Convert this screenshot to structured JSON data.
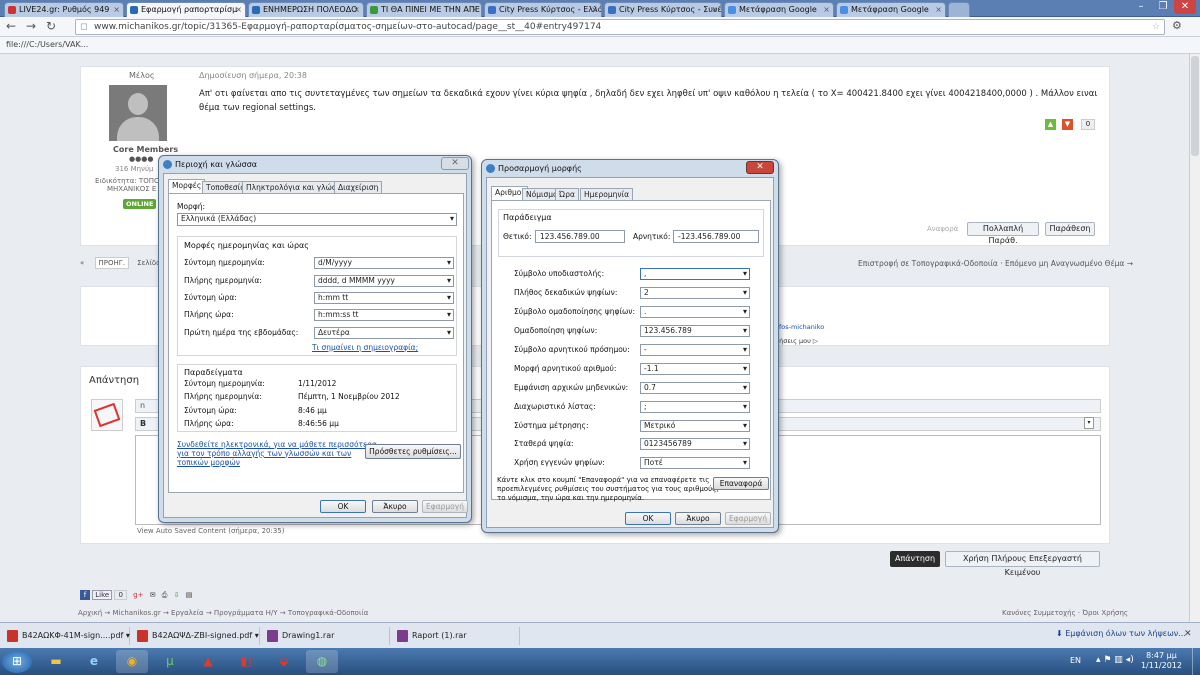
{
  "browser": {
    "tabs": [
      {
        "label": "LIVE24.gr: Ρυθμός 949",
        "active": false
      },
      {
        "label": "Εφαρμογή ραπορταρίσμ",
        "active": true
      },
      {
        "label": "ΕΝΗΜΕΡΩΣΗ ΠΟΛΕΟΔΟ",
        "active": false
      },
      {
        "label": "ΤΙ ΘΑ ΠΙΝΕΙ ΜΕ ΤΗΝ ΑΠΕ",
        "active": false
      },
      {
        "label": "City Press Κύρτσος - Ελλά",
        "active": false
      },
      {
        "label": "City Press Κύρτσος - Συνέ",
        "active": false
      },
      {
        "label": "Μετάφραση Google",
        "active": false
      },
      {
        "label": "Μετάφραση Google",
        "active": false
      }
    ],
    "url": "www.michanikos.gr/topic/31365-Εφαρμογή-ραπορταρίσματος-σημείων-στο-autocad/page__st__40#entry497174",
    "bookmark": "file:///C:/Users/VAK..."
  },
  "forum": {
    "author_name": "Μέλος",
    "post_date": "Δημοσίευση σήμερα, 20:38",
    "post_text": "Απ' οτι φαίνεται απο τις συντεταγμένες των σημείων  τα δεκαδικά εχουν γίνει κύρια ψηφία , δηλαδή δεν εχει ληφθεί υπ' οψιν καθόλου η τελεία ( το Χ= 400421.8400  εχει γίνει  4004218400,0000  ) . Μάλλον ειναι θέμα των regional settings.",
    "rank": "Core Members",
    "post_count": "316 Μηνύμ",
    "specialty_line1": "Ειδικότητα: ΤΟΠΟ",
    "specialty_line2": "ΜΗΧΑΝΙΚΟΣ Ε",
    "online_badge": "ONLINE",
    "rep_count": "0",
    "report_label": "Αναφορά",
    "multi_quote_label": "Πολλαπλή Παράθ.",
    "quote_label": "Παράθεση",
    "prev_label": "ΠΡΟΗΓ.",
    "page_label": "Σελίδα",
    "nav_links": "Επιστροφή σε Τοπογραφικά-Οδοποιία · Επόμενο μη Αναγνωσμένο Θέμα →",
    "link_fragment": "ofos-michaniko",
    "share_fragment": "ρήσεις μου",
    "reply_heading": "Απάντηση",
    "autosave_text": "View Auto Saved Content (σήμερα, 20:35)",
    "reply_button": "Απάντηση",
    "full_editor_button": "Χρήση Πλήρους Επεξεργαστή Κειμένου",
    "like_label": "Like",
    "like_count": "0",
    "breadcrumb": "Αρχική  →  Michanikos.gr  →  Εργαλεία  →  Προγράμματα Η/Υ  →  Τοπογραφικά-Οδοποιία",
    "footer_links": "Κανόνες Συμμετοχής · Όροι Χρήσης"
  },
  "region_dialog": {
    "title": "Περιοχή και γλώσσα",
    "tabs": [
      "Μορφές",
      "Τοποθεσία",
      "Πληκτρολόγια και γλώσσες",
      "Διαχείριση"
    ],
    "format_label": "Μορφή:",
    "format_value": "Ελληνικά (Ελλάδας)",
    "group_title": "Μορφές ημερομηνίας και ώρας",
    "rows": [
      {
        "label": "Σύντομη ημερομηνία:",
        "value": "d/M/yyyy"
      },
      {
        "label": "Πλήρης ημερομηνία:",
        "value": "dddd, d MMMM yyyy"
      },
      {
        "label": "Σύντομη ώρα:",
        "value": "h:mm tt"
      },
      {
        "label": "Πλήρης ώρα:",
        "value": "h:mm:ss tt"
      },
      {
        "label": "Πρώτη ημέρα της εβδομάδας:",
        "value": "Δευτέρα"
      }
    ],
    "notation_link": "Τι σημαίνει η σημειογραφία;",
    "examples_title": "Παραδείγματα",
    "examples": [
      {
        "label": "Σύντομη ημερομηνία:",
        "value": "1/11/2012"
      },
      {
        "label": "Πλήρης ημερομηνία:",
        "value": "Πέμπτη, 1 Νοεμβρίου 2012"
      },
      {
        "label": "Σύντομη ώρα:",
        "value": "8:46 μμ"
      },
      {
        "label": "Πλήρης ώρα:",
        "value": "8:46:56 μμ"
      }
    ],
    "online_link_1": "Συνδεθείτε ηλεκτρονικά, για να μάθετε περισσότερα",
    "online_link_2": "για τον τρόπο αλλαγής των γλωσσών και των",
    "online_link_3": "τοπικών μορφών",
    "additional_button": "Πρόσθετες ρυθμίσεις...",
    "ok": "OK",
    "cancel": "Άκυρο",
    "apply": "Εφαρμογή"
  },
  "custom_dialog": {
    "title": "Προσαρμογή μορφής",
    "tabs": [
      "Αριθμοί",
      "Νόμισμα",
      "Ώρα",
      "Ημερομηνία"
    ],
    "example_title": "Παράδειγμα",
    "positive_label": "Θετικό:",
    "positive_value": "123.456.789.00",
    "negative_label": "Αρνητικό:",
    "negative_value": "-123.456.789.00",
    "rows": [
      {
        "label": "Σύμβολο υποδιαστολής:",
        "value": ","
      },
      {
        "label": "Πλήθος δεκαδικών ψηφίων:",
        "value": "2"
      },
      {
        "label": "Σύμβολο ομαδοποίησης ψηφίων:",
        "value": "."
      },
      {
        "label": "Ομαδοποίηση ψηφίων:",
        "value": "123.456.789"
      },
      {
        "label": "Σύμβολο αρνητικού πρόσημου:",
        "value": "-"
      },
      {
        "label": "Μορφή αρνητικού αριθμού:",
        "value": "-1.1"
      },
      {
        "label": "Εμφάνιση αρχικών μηδενικών:",
        "value": "0.7"
      },
      {
        "label": "Διαχωριστικό λίστας:",
        "value": ";"
      },
      {
        "label": "Σύστημα μέτρησης:",
        "value": "Μετρικό"
      },
      {
        "label": "Σταθερά ψηφία:",
        "value": "0123456789"
      },
      {
        "label": "Χρήση εγγενών ψηφίων:",
        "value": "Ποτέ"
      }
    ],
    "reset_text_1": "Κάντε κλικ στο κουμπί \"Επαναφορά\" για να επαναφέρετε τις",
    "reset_text_2": "προεπιλεγμένες ρυθμίσεις του συστήματος για τους αριθμούς,",
    "reset_text_3": "το νόμισμα, την ώρα και την ημερομηνία.",
    "reset_button": "Επαναφορά",
    "ok": "OK",
    "cancel": "Άκυρο",
    "apply": "Εφαρμογή"
  },
  "downloads": {
    "items": [
      "Β42ΑΩΚΦ-41Μ-sign....pdf",
      "Β42ΑΩΨΔ-ΖΒΙ-signed.pdf",
      "Drawing1.rar",
      "Raport (1).rar"
    ],
    "show_all": "Εμφάνιση όλων των λήψεων..."
  },
  "taskbar": {
    "lang": "EN",
    "time": "8:47 μμ",
    "date": "1/11/2012"
  }
}
